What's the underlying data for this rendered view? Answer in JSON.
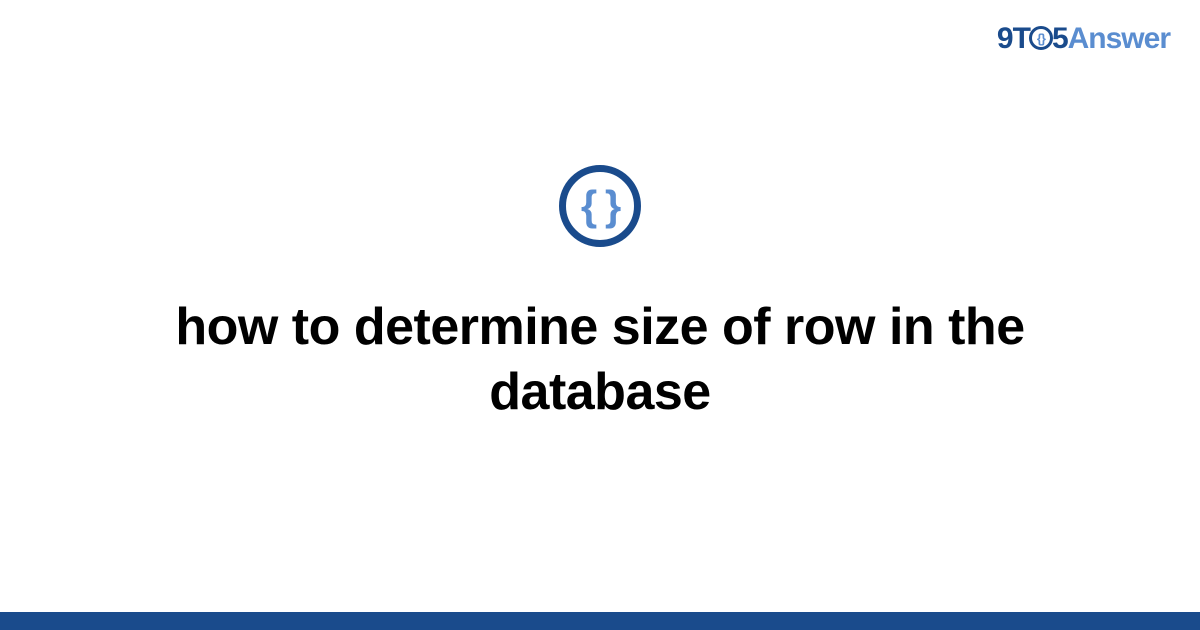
{
  "brand": {
    "prefix1": "9T",
    "circle_glyph": "{}",
    "prefix2": "5",
    "suffix": "Answer"
  },
  "icon": {
    "braces": "{ }"
  },
  "page": {
    "title": "how to determine size of row in the database"
  },
  "colors": {
    "primary": "#1a4b8c",
    "accent": "#5a8dd0"
  }
}
